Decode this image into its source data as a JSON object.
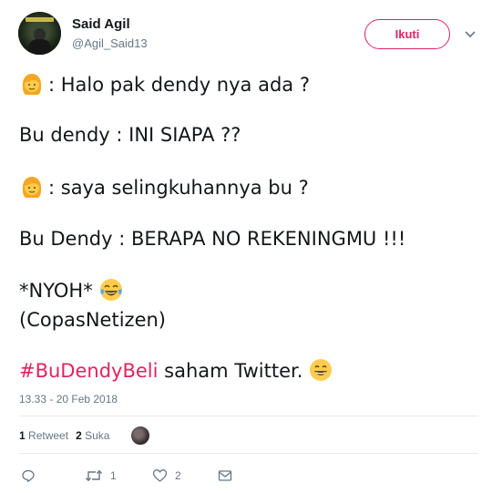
{
  "user": {
    "name": "Said Agil",
    "handle": "@Agil_Said13"
  },
  "follow_button": "Ikuti",
  "tweet": {
    "line1": ": Halo pak dendy nya ada ?",
    "line2": "Bu dendy : INI SIAPA ??",
    "line3": ": saya selingkuhannya bu ?",
    "line4": "Bu Dendy : BERAPA NO REKENINGMU !!!",
    "line5": "*NYOH*",
    "line6": "(CopasNetizen)",
    "hashtag": "#BuDendyBeli",
    "line7_rest": " saham Twitter."
  },
  "timestamp": "13.33 - 20 Feb 2018",
  "stats": {
    "retweets_count": "1",
    "retweets_label": "Retweet",
    "likes_count": "2",
    "likes_label": "Suka"
  },
  "actions": {
    "retweet_count": "1",
    "like_count": "2"
  },
  "colors": {
    "accent": "#e0245e",
    "secondary_text": "#657786",
    "divider": "#e6ecf0"
  },
  "icons": [
    "woman-emoji",
    "tears-of-joy-emoji",
    "grinning-emoji",
    "reply-icon",
    "retweet-icon",
    "heart-icon",
    "message-icon",
    "chevron-down-icon"
  ]
}
